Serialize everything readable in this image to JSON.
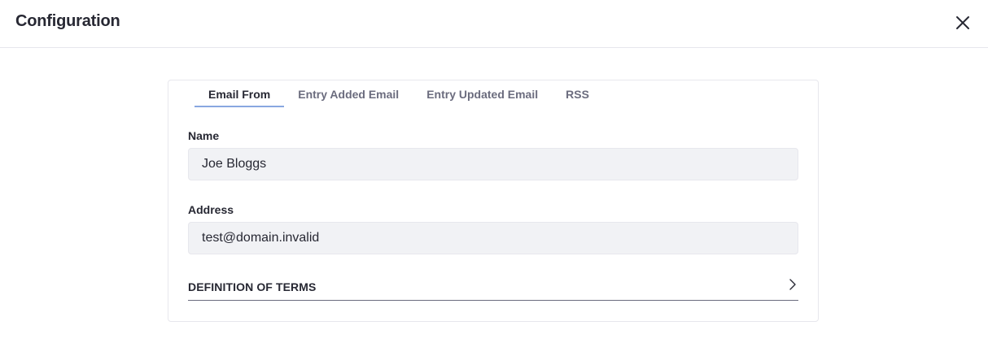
{
  "header": {
    "title": "Configuration",
    "close_icon": "close-icon"
  },
  "tabs": [
    {
      "label": "Email From",
      "active": true
    },
    {
      "label": "Entry Added Email",
      "active": false
    },
    {
      "label": "Entry Updated Email",
      "active": false
    },
    {
      "label": "RSS",
      "active": false
    }
  ],
  "form": {
    "name_label": "Name",
    "name_value": "Joe Bloggs",
    "address_label": "Address",
    "address_value": "test@domain.invalid"
  },
  "terms": {
    "label": "DEFINITION OF TERMS",
    "icon": "chevron-right-icon"
  },
  "colors": {
    "active_tab_underline": "#89a7e0",
    "input_bg": "#f1f2f5",
    "border": "#e7e7ed"
  }
}
